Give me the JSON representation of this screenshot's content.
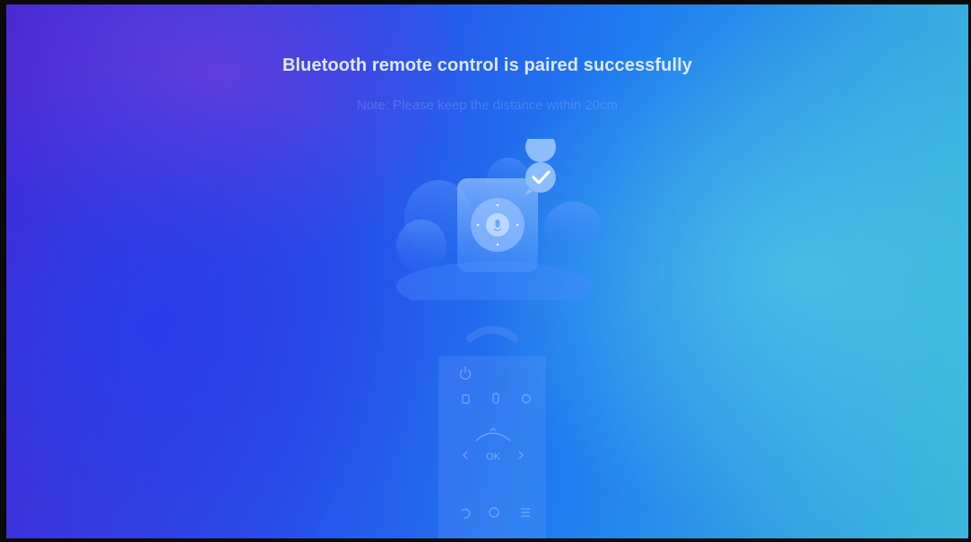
{
  "pairing_screen": {
    "title": "Bluetooth remote control is paired successfully",
    "note": "Note: Please keep the distance within 20cm",
    "success_badge_icon": "checkmark-icon",
    "illustration_icon": "remote-control-icon"
  },
  "remote_buttons": {
    "ok_label": "OK"
  },
  "colors": {
    "bg_left": "#4626d2",
    "bg_mid": "#1f7cf0",
    "bg_right": "#3cb7da",
    "title_text": "#dfe9ff",
    "badge": "#78b6ff"
  }
}
